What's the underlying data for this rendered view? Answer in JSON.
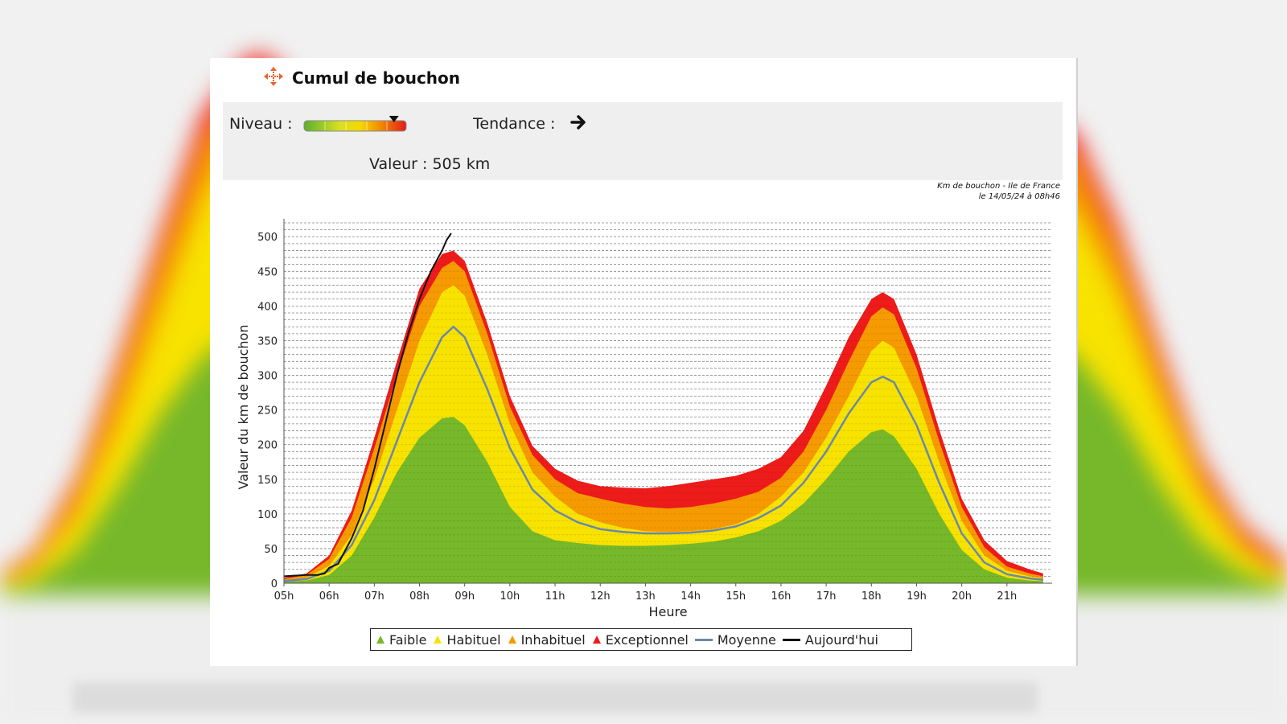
{
  "page": {
    "title": "Cumul de bouchon",
    "level_label": "Niveau :",
    "trend_label": "Tendance :",
    "trend_icon": "arrow-right-icon",
    "value_label": "Valeur : 505 km",
    "caption_line1": "Km de bouchon - Ile de France",
    "caption_line2": "le 14/05/24 à 08h46",
    "level_fraction": 0.88,
    "colors": {
      "faible": "#76b82a",
      "habituel": "#f7e200",
      "inhabituel": "#f59a00",
      "exceptionnel": "#ee1b1b",
      "moyenne": "#6b88a8",
      "aujourdhui": "#111111"
    }
  },
  "chart_data": {
    "type": "area",
    "title": "",
    "xlabel": "Heure",
    "ylabel": "Valeur du  km de bouchon",
    "x_ticks": [
      "05h",
      "06h",
      "07h",
      "08h",
      "09h",
      "10h",
      "11h",
      "12h",
      "13h",
      "14h",
      "15h",
      "16h",
      "17h",
      "18h",
      "19h",
      "20h",
      "21h"
    ],
    "xlim": [
      5.0,
      22.0
    ],
    "ylim": [
      0,
      520
    ],
    "y_ticks": [
      0,
      50,
      100,
      150,
      200,
      250,
      300,
      350,
      400,
      450,
      500
    ],
    "x": [
      5.0,
      5.5,
      6.0,
      6.5,
      7.0,
      7.5,
      8.0,
      8.5,
      8.75,
      9.0,
      9.5,
      10.0,
      10.5,
      11.0,
      11.5,
      12.0,
      12.5,
      13.0,
      13.5,
      14.0,
      14.5,
      15.0,
      15.5,
      16.0,
      16.5,
      17.0,
      17.5,
      18.0,
      18.25,
      18.5,
      19.0,
      19.5,
      20.0,
      20.5,
      21.0,
      21.5,
      21.8
    ],
    "series": [
      {
        "name": "Faible",
        "values": [
          2,
          4,
          12,
          40,
          95,
          160,
          210,
          238,
          240,
          228,
          175,
          110,
          75,
          62,
          58,
          55,
          54,
          54,
          55,
          57,
          60,
          66,
          75,
          90,
          115,
          150,
          190,
          218,
          222,
          212,
          165,
          100,
          48,
          20,
          8,
          4,
          3
        ]
      },
      {
        "name": "Habituel",
        "values": [
          4,
          8,
          25,
          70,
          150,
          250,
          350,
          420,
          430,
          415,
          330,
          230,
          160,
          125,
          100,
          88,
          80,
          75,
          74,
          75,
          78,
          85,
          100,
          125,
          160,
          210,
          270,
          335,
          350,
          340,
          270,
          175,
          90,
          40,
          18,
          10,
          7
        ]
      },
      {
        "name": "Inhabituel",
        "values": [
          6,
          12,
          35,
          95,
          195,
          300,
          400,
          455,
          465,
          450,
          360,
          255,
          185,
          150,
          130,
          122,
          115,
          110,
          108,
          110,
          115,
          122,
          132,
          152,
          190,
          250,
          320,
          385,
          398,
          388,
          310,
          205,
          110,
          52,
          24,
          14,
          10
        ]
      },
      {
        "name": "Exceptionnel",
        "values": [
          8,
          14,
          40,
          105,
          210,
          320,
          425,
          475,
          480,
          465,
          375,
          270,
          198,
          165,
          148,
          140,
          138,
          137,
          140,
          145,
          150,
          155,
          165,
          182,
          220,
          285,
          355,
          410,
          420,
          410,
          330,
          222,
          122,
          62,
          32,
          20,
          14
        ]
      },
      {
        "name": "Moyenne",
        "values": [
          3,
          6,
          18,
          55,
          120,
          205,
          290,
          355,
          370,
          355,
          280,
          195,
          135,
          105,
          88,
          78,
          74,
          72,
          72,
          73,
          76,
          82,
          94,
          112,
          145,
          190,
          245,
          290,
          298,
          290,
          228,
          145,
          72,
          30,
          13,
          7,
          5
        ]
      }
    ],
    "today": {
      "name": "Aujourd'hui",
      "x": [
        5.0,
        5.25,
        5.5,
        5.75,
        5.9,
        6.0,
        6.2,
        6.5,
        6.75,
        7.0,
        7.25,
        7.5,
        7.75,
        8.0,
        8.25,
        8.5,
        8.6,
        8.7
      ],
      "values": [
        10,
        11,
        12,
        12,
        14,
        22,
        28,
        65,
        105,
        165,
        232,
        300,
        360,
        410,
        450,
        480,
        495,
        505
      ]
    },
    "legend": [
      "Faible",
      "Habituel",
      "Inhabituel",
      "Exceptionnel",
      "Moyenne",
      "Aujourd'hui"
    ],
    "legend_position": "bottom",
    "grid": true
  }
}
